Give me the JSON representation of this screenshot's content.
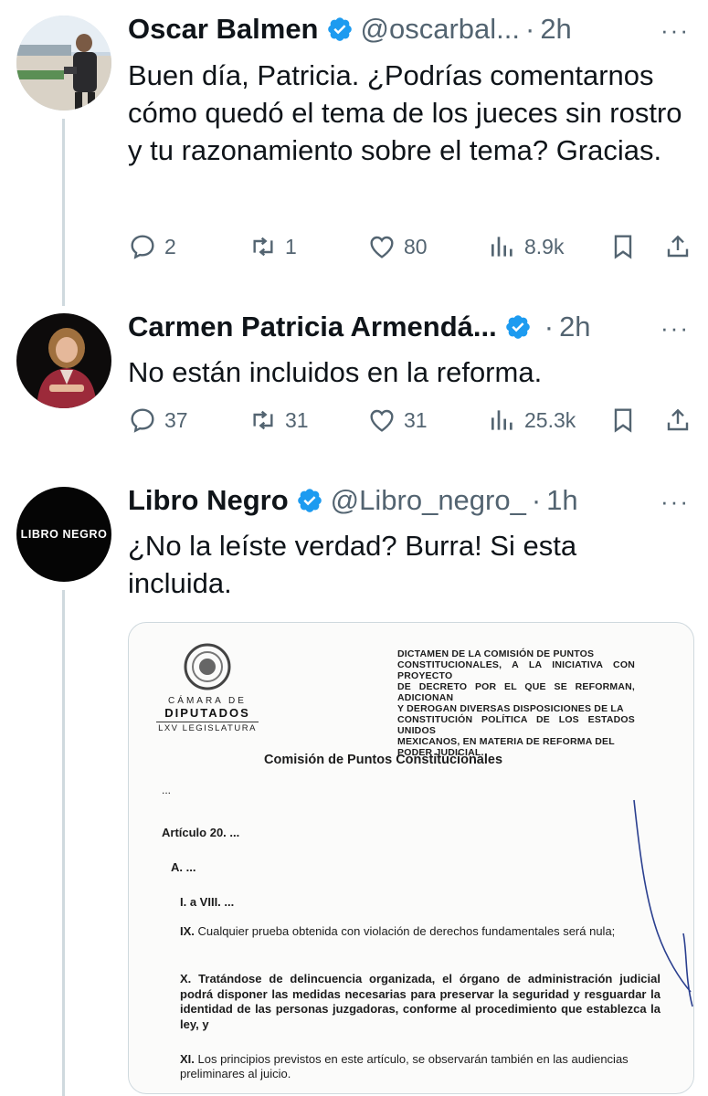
{
  "tweets": [
    {
      "name": "Oscar Balmen",
      "handle": "@oscarbal...",
      "time": "2h",
      "text": "Buen día, Patricia. ¿Podrías comentarnos cómo quedó el tema de los jueces sin rostro y tu razonamiento sobre el tema? Gracias.",
      "replies": "2",
      "retweets": "1",
      "likes": "80",
      "views": "8.9k"
    },
    {
      "name": "Carmen Patricia Armendá...",
      "handle": "",
      "time": "2h",
      "text": "No están incluidos en la reforma.",
      "replies": "37",
      "retweets": "31",
      "likes": "31",
      "views": "25.3k"
    },
    {
      "name": "Libro Negro",
      "handle": "@Libro_negro_",
      "time": "1h",
      "text": "¿No la leíste verdad? Burra! Si esta incluida.",
      "avatar_text": "LIBRO NEGRO"
    }
  ],
  "more_icon": "···",
  "dot": "·",
  "colors": {
    "verified": "#1d9bf0",
    "secondary_text": "#536471",
    "thread_line": "#cfd9de"
  },
  "document": {
    "seal_upper": "CÁMARA DE",
    "seal_main": "DIPUTADOS",
    "seal_sub": "LXV LEGISLATURA",
    "header_lines": [
      "DICTAMEN DE LA COMISIÓN DE PUNTOS",
      "CONSTITUCIONALES, A LA INICIATIVA CON PROYECTO",
      "DE DECRETO POR EL QUE SE REFORMAN, ADICIONAN",
      "Y DEROGAN DIVERSAS DISPOSICIONES DE LA",
      "CONSTITUCIÓN POLÍTICA DE LOS ESTADOS UNIDOS",
      "MEXICANOS, EN MATERIA DE REFORMA DEL",
      "PODER JUDICIAL."
    ],
    "title": "Comisión de Puntos Constitucionales",
    "ellipsis": "...",
    "articulo": "Artículo 20. ...",
    "a": "A. ...",
    "i_viii": "I. a VIII. ...",
    "ix_num": "IX.",
    "ix_text": "Cualquier prueba obtenida con violación de derechos fundamentales será nula;",
    "x_text": "X. Tratándose de delincuencia organizada, el órgano de administración judicial podrá disponer las medidas necesarias para preservar la seguridad y resguardar la identidad de las personas juzgadoras, conforme al procedimiento que establezca la ley, y",
    "xi_num": "XI.",
    "xi_text": "Los principios previstos en este artículo, se observarán también en las audiencias preliminares al juicio."
  }
}
